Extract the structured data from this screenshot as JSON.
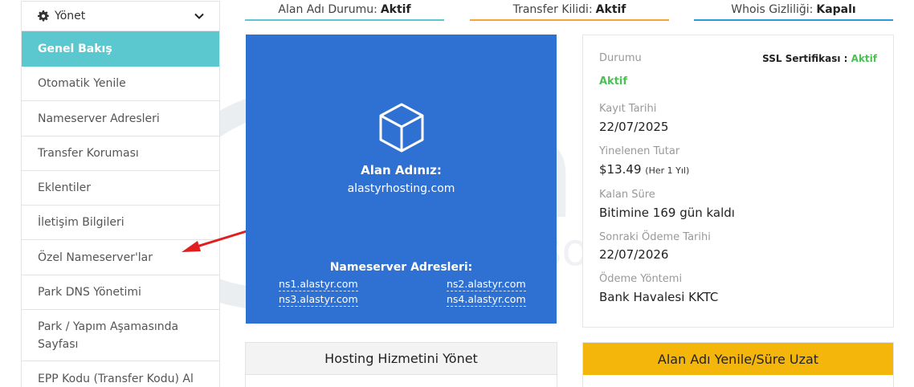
{
  "status_tabs": [
    {
      "label": "Alan Adı Durumu:",
      "value": "Aktif",
      "color": "#5bc8cf"
    },
    {
      "label": "Transfer Kilidi:",
      "value": "Aktif",
      "color": "#f0a830"
    },
    {
      "label": "Whois Gizliliği:",
      "value": "Kapalı",
      "color": "#2a9bd6"
    }
  ],
  "sidebar": {
    "header": "Yönet",
    "items": [
      {
        "label": "Genel Bakış",
        "active": true
      },
      {
        "label": "Otomatik Yenile"
      },
      {
        "label": "Nameserver Adresleri"
      },
      {
        "label": "Transfer Koruması"
      },
      {
        "label": "Eklentiler"
      },
      {
        "label": "İletişim Bilgileri"
      },
      {
        "label": "Özel Nameserver'lar"
      },
      {
        "label": "Park DNS Yönetimi"
      },
      {
        "label": "Park / Yapım Aşamasında Sayfası"
      },
      {
        "label": "EPP Kodu (Transfer Kodu) Al"
      }
    ]
  },
  "domain_box": {
    "label": "Alan Adınız:",
    "domain": "alastyrhosting.com",
    "ns_label": "Nameserver Adresleri:",
    "nameservers": [
      "ns1.alastyr.com",
      "ns2.alastyr.com",
      "ns3.alastyr.com",
      "ns4.alastyr.com"
    ],
    "bg_color": "#2f70d3"
  },
  "info": {
    "status_label": "Durumu",
    "status_value": "Aktif",
    "ssl_label": "SSL Sertifikası :",
    "ssl_value": "Aktif",
    "reg_date_label": "Kayıt Tarihi",
    "reg_date": "22/07/2025",
    "renew_amount_label": "Yinelenen Tutar",
    "renew_amount": "$13.49",
    "renew_period": "(Her 1 Yıl)",
    "remaining_label": "Kalan Süre",
    "remaining": "Bitimine 169 gün kaldı",
    "next_due_label": "Sonraki Ödeme Tarihi",
    "next_due": "22/07/2026",
    "payment_label": "Ödeme Yöntemi",
    "payment": "Bank Havalesi KKTC"
  },
  "bottom": {
    "hosting_title": "Hosting Hizmetini Yönet",
    "renew_title": "Alan Adı Yenile/Süre Uzat",
    "renew_color": "#f5b60c"
  },
  "watermark": {
    "brand": "alastyr",
    "tagline": "solutions"
  }
}
